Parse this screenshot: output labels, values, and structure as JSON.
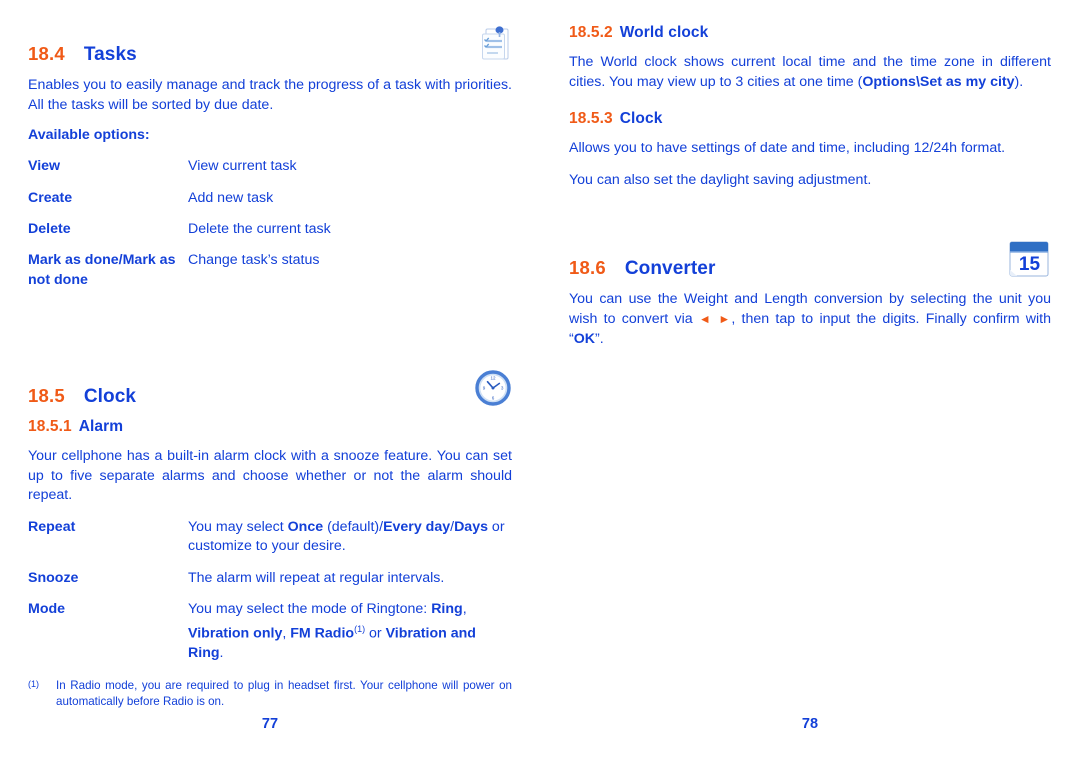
{
  "colors": {
    "accent_orange": "#f05a17",
    "text_blue": "#1340d8",
    "background": "#ffffff"
  },
  "left_page": {
    "page_number": "77",
    "sections": {
      "tasks": {
        "number": "18.4",
        "title": "Tasks",
        "icon": "notepad-icon",
        "intro": "Enables you to easily manage and track the progress of a task with priorities. All the tasks will be sorted by due date.",
        "options_label": "Available options:",
        "options": [
          {
            "key": "View",
            "value": "View current task"
          },
          {
            "key": "Create",
            "value": "Add new task"
          },
          {
            "key": "Delete",
            "value": "Delete the current task"
          },
          {
            "key": "Mark as done/Mark as not done",
            "value": "Change task’s status"
          }
        ]
      },
      "clock": {
        "number": "18.5",
        "title": "Clock",
        "icon": "analog-clock-icon",
        "alarm": {
          "number": "18.5.1",
          "title": "Alarm",
          "intro": "Your cellphone has a built-in alarm clock with a snooze feature. You can set up to five separate alarms and choose whether or not the alarm should repeat.",
          "options": [
            {
              "key": "Repeat",
              "value_prefix": "You may select ",
              "bold1": "Once",
              "mid1": " (default)/",
              "bold2": "Every day",
              "mid2": "/",
              "bold3": "Days",
              "tail": " or customize to your desire."
            },
            {
              "key": "Snooze",
              "value": "The alarm will repeat at regular intervals."
            },
            {
              "key": "Mode",
              "value_prefix": "You may select the mode of Ringtone: ",
              "bold1": "Ring",
              "mid1": ", ",
              "bold2": "Vibration only",
              "mid2": ", ",
              "bold3": "FM Radio",
              "footnote_marker": "(1)",
              "mid3": " or ",
              "bold4": "Vibration and Ring",
              "tail": "."
            }
          ]
        }
      }
    },
    "footnote": {
      "marker": "(1)",
      "text": "In Radio mode, you are required to plug in headset first. Your cellphone will power on automatically before Radio is on."
    }
  },
  "right_page": {
    "page_number": "78",
    "sections": {
      "world_clock": {
        "number": "18.5.2",
        "title": "World clock",
        "text_prefix": "The World clock shows current local time and the time zone in different cities. You may view up to 3 cities at one time (",
        "bold": "Options\\Set as my city",
        "text_suffix": ")."
      },
      "clock_settings": {
        "number": "18.5.3",
        "title": "Clock",
        "paragraph1": "Allows you to have settings of date and time, including 12/24h format.",
        "paragraph2": "You can also set the daylight saving adjustment."
      },
      "converter": {
        "number": "18.6",
        "title": "Converter",
        "icon": "calendar-icon",
        "icon_day": "15",
        "text_prefix": "You can use the Weight and Length conversion by selecting the unit you wish to convert via ",
        "arrows": "◄ ►",
        "text_mid": ", then tap to input the digits. Finally confirm with “",
        "bold": "OK",
        "text_suffix": "”."
      }
    }
  },
  "leader_dots": "........................................................................................"
}
